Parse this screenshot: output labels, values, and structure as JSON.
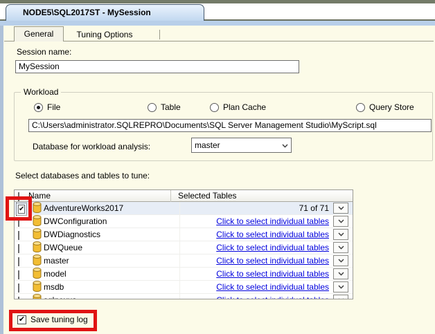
{
  "window": {
    "session_tab_title": "NODE5\\SQL2017ST - MySession"
  },
  "tabs": {
    "general_label": "General",
    "tuning_options_label": "Tuning Options",
    "selected": "General"
  },
  "general": {
    "session_name_label": "Session name:",
    "session_name_value": "MySession",
    "workload": {
      "group_label": "Workload",
      "options": [
        {
          "label": "File",
          "selected": true
        },
        {
          "label": "Table",
          "selected": false
        },
        {
          "label": "Plan Cache",
          "selected": false
        },
        {
          "label": "Query Store",
          "selected": false
        }
      ],
      "file_path_value": "C:\\Users\\administrator.SQLREPRO\\Documents\\SQL Server Management Studio\\MyScript.sql",
      "database_label": "Database for workload analysis:",
      "database_value": "master"
    },
    "select_tables_label": "Select databases and tables to tune:",
    "table": {
      "columns": {
        "name": "Name",
        "selected_tables": "Selected Tables"
      },
      "rows": [
        {
          "name": "AdventureWorks2017",
          "checked": true,
          "highlighted": true,
          "selected_tables": "71 of 71",
          "link": false
        },
        {
          "name": "DWConfiguration",
          "checked": false,
          "highlighted": false,
          "selected_tables": "Click to select individual tables",
          "link": true
        },
        {
          "name": "DWDiagnostics",
          "checked": false,
          "highlighted": false,
          "selected_tables": "Click to select individual tables",
          "link": true
        },
        {
          "name": "DWQueue",
          "checked": false,
          "highlighted": false,
          "selected_tables": "Click to select individual tables",
          "link": true
        },
        {
          "name": "master",
          "checked": false,
          "highlighted": false,
          "selected_tables": "Click to select individual tables",
          "link": true
        },
        {
          "name": "model",
          "checked": false,
          "highlighted": false,
          "selected_tables": "Click to select individual tables",
          "link": true
        },
        {
          "name": "msdb",
          "checked": false,
          "highlighted": false,
          "selected_tables": "Click to select individual tables",
          "link": true
        },
        {
          "name": "sqlnexus",
          "checked": false,
          "highlighted": false,
          "selected_tables": "Click to select individual tables",
          "link": true
        }
      ]
    },
    "save_tuning_log_label": "Save tuning log",
    "save_tuning_log_checked": true
  },
  "icons": {
    "database": "database-cylinder-icon",
    "dropdown": "chevron-down-icon",
    "checkmark": "✔"
  },
  "annotation": {
    "color": "#e01414",
    "highlight_1": "checkbox of AdventureWorks2017 row",
    "highlight_2": "Save tuning log checkbox"
  }
}
